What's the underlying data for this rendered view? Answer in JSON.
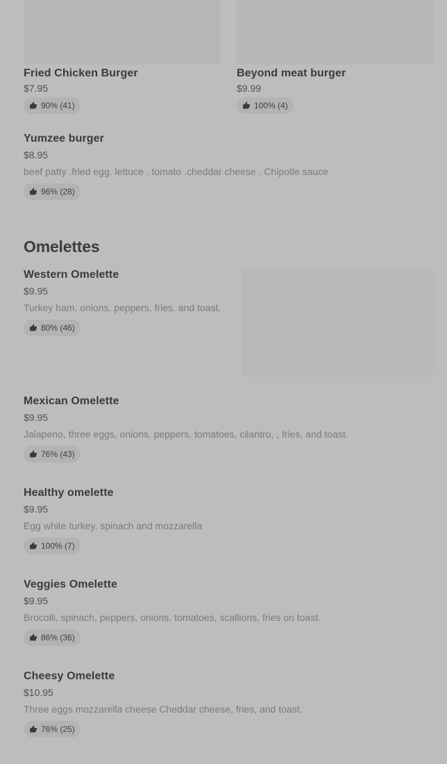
{
  "burgers": {
    "grid": [
      {
        "name": "Fried Chicken Burger",
        "price": "$7.95",
        "rating": "90% (41)"
      },
      {
        "name": "Beyond meat burger",
        "price": "$9.99",
        "rating": "100% (4)"
      }
    ],
    "yumzee": {
      "name": "Yumzee burger",
      "price": "$8.95",
      "description": "beef patty .fried egg. lettuce . tomato .cheddar cheese . Chipotle sauce",
      "rating": "96% (28)"
    }
  },
  "omelettes": {
    "title": "Omelettes",
    "items": [
      {
        "name": "Western Omelette",
        "price": "$9.95",
        "description": "Turkey ham, onions, peppers, fries, and toast.",
        "rating": "80% (46)"
      },
      {
        "name": "Mexican Omelette",
        "price": "$9.95",
        "description": "Jalapeno, three eggs, onions, peppers, tomatoes, cilantro, , fries, and toast.",
        "rating": "76% (43)"
      },
      {
        "name": "Healthy omelette",
        "price": "$9.95",
        "description": "Egg white turkey. spinach and mozzarella",
        "rating": "100% (7)"
      },
      {
        "name": "Veggies Omelette",
        "price": "$9.95",
        "description": "Brocolli, spinach, peppers, onions, tomatoes, scallions, fries on toast.",
        "rating": "86% (36)"
      },
      {
        "name": "Cheesy Omelette",
        "price": "$10.95",
        "description": "Three eggs mozzarella cheese Cheddar cheese, fries, and toast.",
        "rating": "76% (25)"
      }
    ]
  },
  "icons": {
    "rating": "thumbs-up-icon"
  }
}
